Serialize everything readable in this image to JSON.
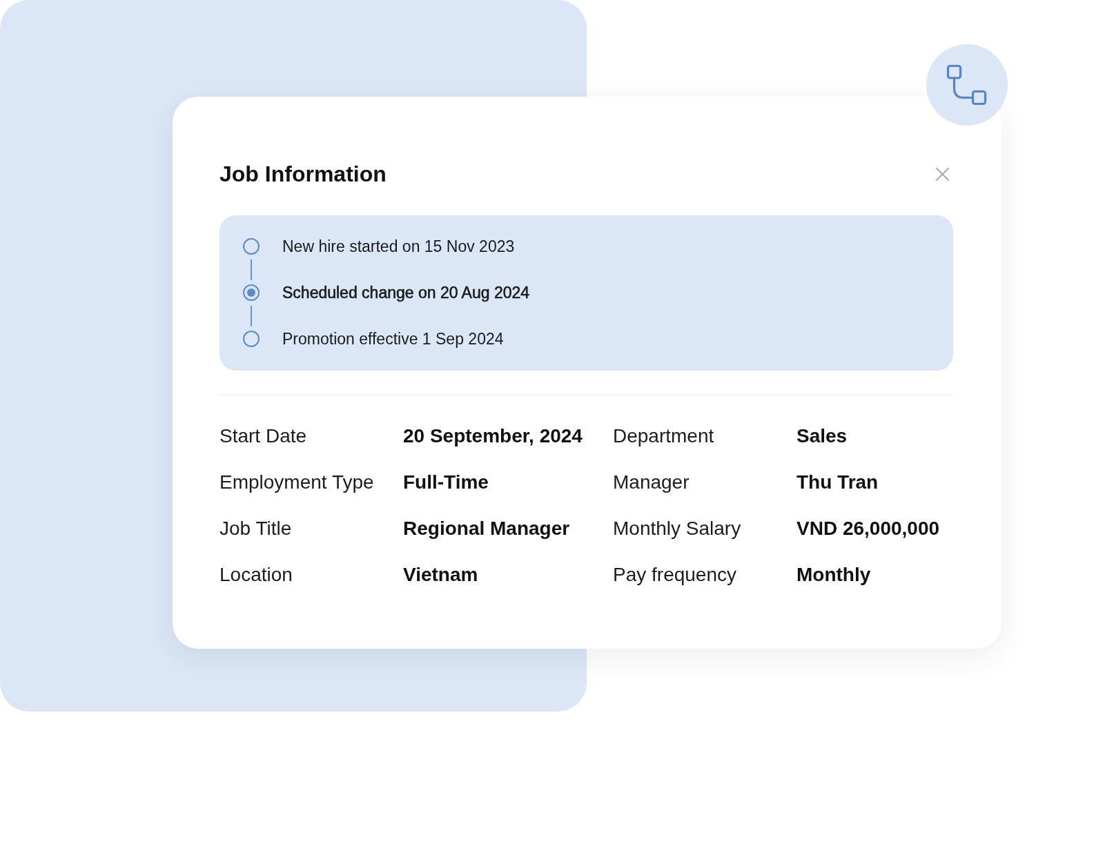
{
  "dialog": {
    "title": "Job Information",
    "timeline": [
      {
        "label": "New hire started on 15 Nov 2023",
        "selected": false
      },
      {
        "label": "Scheduled change on 20 Aug 2024",
        "selected": true
      },
      {
        "label": "Promotion effective 1 Sep 2024",
        "selected": false
      }
    ],
    "fields": [
      {
        "label": "Start Date",
        "value": "20 September, 2024"
      },
      {
        "label": "Department",
        "value": "Sales"
      },
      {
        "label": "Employment Type",
        "value": "Full-Time"
      },
      {
        "label": "Manager",
        "value": "Thu Tran"
      },
      {
        "label": "Job Title",
        "value": "Regional Manager"
      },
      {
        "label": "Monthly Salary",
        "value": "VND 26,000,000"
      },
      {
        "label": "Location",
        "value": "Vietnam"
      },
      {
        "label": "Pay frequency",
        "value": "Monthly"
      }
    ]
  }
}
